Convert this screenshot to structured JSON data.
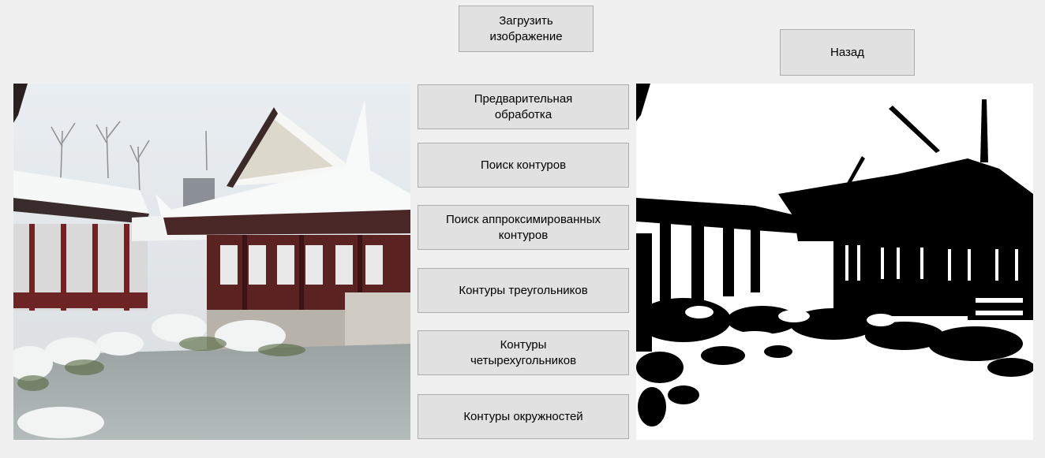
{
  "buttons": {
    "load": "Загрузить\nизображение",
    "back": "Назад",
    "preprocess": "Предварительная\nобработка",
    "contours": "Поиск контуров",
    "approx": "Поиск аппроксимированных\nконтуров",
    "triangles": "Контуры треугольников",
    "quads": "Контуры\nчетырехугольников",
    "circles": "Контуры окружностей"
  },
  "images": {
    "original": {
      "content": "snow-covered Chinese pavilion with frozen pond (color photo)"
    },
    "processed": {
      "content": "binarized black-and-white version of the pavilion photo"
    }
  },
  "colors": {
    "window_bg": "#f0f0f0",
    "button_bg": "#e1e1e1",
    "button_border": "#adadad"
  }
}
